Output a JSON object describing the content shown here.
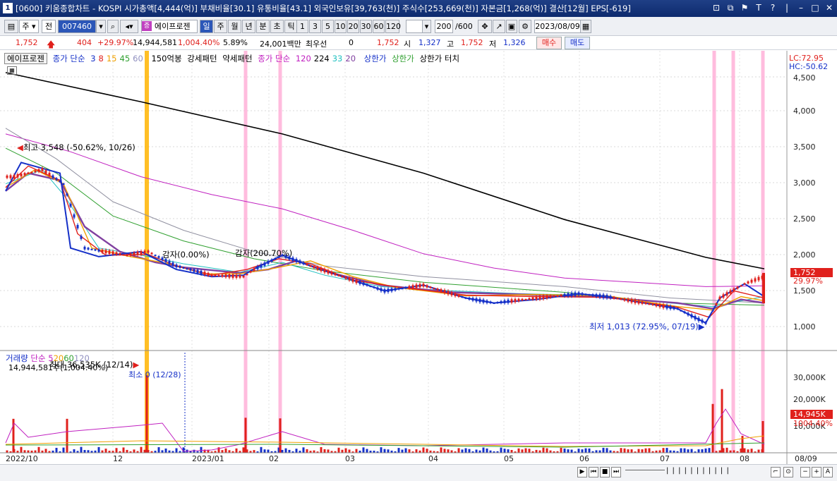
{
  "window": {
    "title": "[0600] 키움종합차트 - KOSPI 시가총액[4,444(억)] 부채비율[30.1] 유통비율[43.1] 외국인보유[39,763(천)] 주식수[253,669(천)] 자본금[1,268(억)] 결산[12월] EPS[-619]",
    "icon_label": "1"
  },
  "toolbar": {
    "market": "주",
    "prev": "전",
    "code": "007460",
    "security_name": "에이프로젠",
    "period_buttons": [
      "일",
      "주",
      "월",
      "년",
      "분",
      "초",
      "틱"
    ],
    "selected_period": "일",
    "interval_buttons": [
      "1",
      "3",
      "5",
      "10",
      "20",
      "30",
      "60",
      "120"
    ],
    "count": "200",
    "count_total": "/600",
    "date": "2023/08/09"
  },
  "info": {
    "price": "1,752",
    "change": "404",
    "change_pct": "+29.97%",
    "volume": "14,944,581",
    "volume_pct": "1,004.40%",
    "turnover": "5.89%",
    "amount": "24,001백만",
    "pref_label": "최우선",
    "pref_value": "0",
    "pref_price": "1,752",
    "open_label": "시",
    "open": "1,327",
    "high_label": "고",
    "high": "1,752",
    "low_label": "저",
    "low": "1,326",
    "buy": "매수",
    "sell": "매도"
  },
  "price_legend": {
    "name": "에이프로젠",
    "ma_label": "종가 단순",
    "ma_periods": [
      "3",
      "8",
      "15",
      "45",
      "60"
    ],
    "ma_colors": [
      "#1530c8",
      "#e0201c",
      "#f0a000",
      "#30a030",
      "#9090c0"
    ],
    "item_150": "150억봉",
    "strong": "강세패턴",
    "weak": "약세패턴",
    "ma2_label": "종가 단순",
    "ma2_periods": [
      "120",
      "224",
      "33",
      "20"
    ],
    "ma2_colors": [
      "#c020c0",
      "#000000",
      "#20c0c0",
      "#8040a0"
    ],
    "upper": "상한가",
    "upper2": "상한가",
    "upper_touch": "상한가 터치"
  },
  "corner": {
    "lc": "LC:72.95",
    "hc": "HC:-50.62"
  },
  "annotations": {
    "high": "최고 3,548 (-50.62%, 10/26)",
    "low": "최저 1,013 (72.95%, 07/19)",
    "reduce": "감자(0.00%)",
    "reduce2": "감자(200.70%)",
    "vol_max": "최대 36,535K (12/14)",
    "vol_min": "최소 0 (12/28)"
  },
  "y_axis": [
    "4,500",
    "4,000",
    "3,500",
    "3,000",
    "2,500",
    "2,000",
    "1,500",
    "1,000"
  ],
  "price_tag": {
    "price": "1,752",
    "pct": "29.97%"
  },
  "volume_legend": {
    "label": "거래량",
    "ma_label": "단순",
    "periods": [
      "5",
      "20",
      "60",
      "120"
    ],
    "colors": [
      "#c020c0",
      "#f0a000",
      "#30a030",
      "#9090c0"
    ],
    "current": "14,944,581주(1,004.40%)"
  },
  "volume_axis": [
    "30,000K",
    "20,000K",
    "10,000K"
  ],
  "volume_tag": {
    "value": "14,945K",
    "pct": "1004.40%"
  },
  "x_axis": [
    "2022/10",
    "12",
    "2023/01",
    "02",
    "03",
    "04",
    "05",
    "06",
    "07",
    "08",
    "08/09"
  ],
  "colors": {
    "up": "#e0201c",
    "down": "#1530c8",
    "highlight_pink": "#ffb0d8",
    "highlight_orange": "#ffb400"
  }
}
